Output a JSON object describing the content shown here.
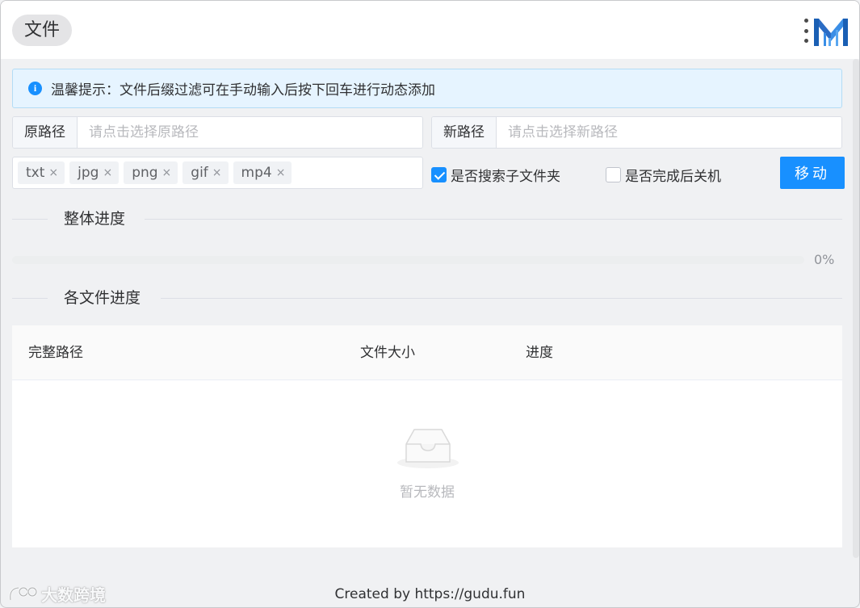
{
  "app": {
    "title": "文件"
  },
  "alert": {
    "icon": "info-icon",
    "icon_glyph": "i",
    "text": "温馨提示：文件后缀过滤可在手动输入后按下回车进行动态添加"
  },
  "source_path": {
    "label": "原路径",
    "placeholder": "请点击选择原路径",
    "value": ""
  },
  "target_path": {
    "label": "新路径",
    "placeholder": "请点击选择新路径",
    "value": ""
  },
  "filters": {
    "tags": [
      "txt",
      "jpg",
      "png",
      "gif",
      "mp4"
    ],
    "close_glyph": "×"
  },
  "options": {
    "search_subfolders": {
      "label": "是否搜索子文件夹",
      "checked": true
    },
    "shutdown_after": {
      "label": "是否完成后关机",
      "checked": false
    }
  },
  "actions": {
    "move_label": "移动"
  },
  "overall_progress": {
    "heading": "整体进度",
    "percent": 0,
    "percent_text": "0%"
  },
  "file_progress": {
    "heading": "各文件进度",
    "columns": [
      "完整路径",
      "文件大小",
      "进度"
    ],
    "rows": [],
    "empty_text": "暂无数据"
  },
  "footer": {
    "text": "Created by https://gudu.fun"
  },
  "watermark": {
    "text": "大数跨境"
  },
  "colors": {
    "primary": "#1890ff",
    "alert_bg": "#e6f4ff",
    "border": "#dcdfe6"
  }
}
